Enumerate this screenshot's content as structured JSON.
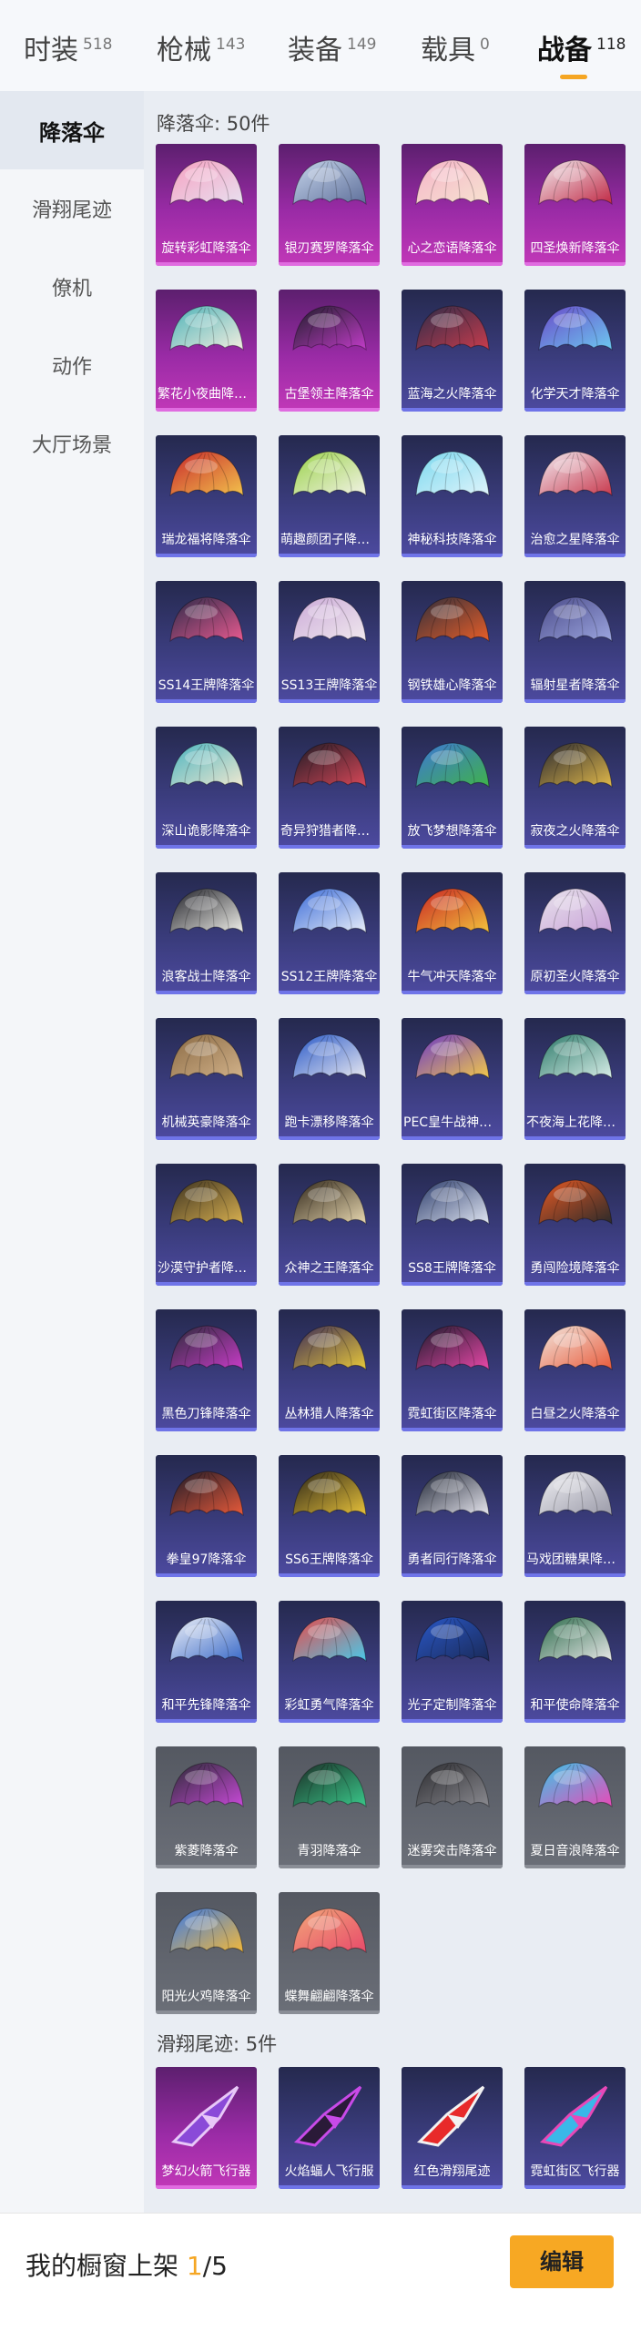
{
  "tabs": [
    {
      "name": "时装",
      "count": "518"
    },
    {
      "name": "枪械",
      "count": "143"
    },
    {
      "name": "装备",
      "count": "149"
    },
    {
      "name": "载具",
      "count": "0"
    },
    {
      "name": "战备",
      "count": "118"
    }
  ],
  "sidebar": [
    "降落伞",
    "滑翔尾迹",
    "僚机",
    "动作",
    "大厅场景"
  ],
  "parachute_section": {
    "title": "降落伞: 50件"
  },
  "trail_section": {
    "title": "滑翔尾迹: 5件"
  },
  "parachutes": [
    {
      "name": "旋转彩虹降落伞",
      "rarity": "purple",
      "colors": [
        "#f6a0c0",
        "#e8e0f0"
      ]
    },
    {
      "name": "银刃赛罗降落伞",
      "rarity": "purple",
      "colors": [
        "#c7d6ec",
        "#5e6f9a"
      ]
    },
    {
      "name": "心之恋语降落伞",
      "rarity": "purple",
      "colors": [
        "#f5b4c9",
        "#f7e3d0"
      ]
    },
    {
      "name": "四圣焕新降落伞",
      "rarity": "purple",
      "colors": [
        "#f3f0f3",
        "#c02844"
      ]
    },
    {
      "name": "繁花小夜曲降落伞",
      "rarity": "purple",
      "colors": [
        "#4cb2b8",
        "#f2eedf"
      ]
    },
    {
      "name": "古堡领主降落伞",
      "rarity": "purple",
      "colors": [
        "#1d1d28",
        "#c13cc8"
      ]
    },
    {
      "name": "蓝海之火降落伞",
      "rarity": "blue",
      "colors": [
        "#2c2c4a",
        "#c83c4c"
      ]
    },
    {
      "name": "化学天才降落伞",
      "rarity": "blue",
      "colors": [
        "#6a48c8",
        "#6cc8f0"
      ]
    },
    {
      "name": "瑞龙福将降落伞",
      "rarity": "blue",
      "colors": [
        "#c8282c",
        "#f2c24c"
      ]
    },
    {
      "name": "萌趣颜团子降落伞",
      "rarity": "blue",
      "colors": [
        "#9ad24a",
        "#f2f2e6"
      ]
    },
    {
      "name": "神秘科技降落伞",
      "rarity": "blue",
      "colors": [
        "#7ad8ee",
        "#dff4fb"
      ]
    },
    {
      "name": "治愈之星降落伞",
      "rarity": "blue",
      "colors": [
        "#f2eef4",
        "#c8384c"
      ]
    },
    {
      "name": "SS14王牌降落伞",
      "rarity": "blue",
      "colors": [
        "#2a2a48",
        "#e85a90"
      ]
    },
    {
      "name": "SS13王牌降落伞",
      "rarity": "blue",
      "colors": [
        "#cbaad8",
        "#f0e8ee"
      ]
    },
    {
      "name": "钢铁雄心降落伞",
      "rarity": "blue",
      "colors": [
        "#2e2e3c",
        "#e85e28"
      ]
    },
    {
      "name": "辐射星者降落伞",
      "rarity": "blue",
      "colors": [
        "#4a4a88",
        "#9ca6e0"
      ]
    },
    {
      "name": "深山诡影降落伞",
      "rarity": "blue",
      "colors": [
        "#4ab4c0",
        "#f0e8d0"
      ]
    },
    {
      "name": "奇异狩猎者降落伞",
      "rarity": "blue",
      "colors": [
        "#1a1a24",
        "#d84858"
      ]
    },
    {
      "name": "放飞梦想降落伞",
      "rarity": "blue",
      "colors": [
        "#3e76d8",
        "#3fb24a"
      ]
    },
    {
      "name": "寂夜之火降落伞",
      "rarity": "blue",
      "colors": [
        "#262630",
        "#e0b84a"
      ]
    },
    {
      "name": "浪客战士降落伞",
      "rarity": "blue",
      "colors": [
        "#1e1e26",
        "#f0f0ea"
      ]
    },
    {
      "name": "SS12王牌降落伞",
      "rarity": "blue",
      "colors": [
        "#3a6ad8",
        "#e8eef8"
      ]
    },
    {
      "name": "牛气冲天降落伞",
      "rarity": "blue",
      "colors": [
        "#c82424",
        "#f2c23c"
      ]
    },
    {
      "name": "原初圣火降落伞",
      "rarity": "blue",
      "colors": [
        "#e8e4ec",
        "#c8a0d8"
      ]
    },
    {
      "name": "机械英豪降落伞",
      "rarity": "blue",
      "colors": [
        "#8a6a44",
        "#d2b28a"
      ]
    },
    {
      "name": "跑卡漂移降落伞",
      "rarity": "blue",
      "colors": [
        "#2858c8",
        "#e8e8f0"
      ]
    },
    {
      "name": "PEC皇牛战神降落伞",
      "rarity": "blue",
      "colors": [
        "#6a38c8",
        "#f2c84a"
      ]
    },
    {
      "name": "不夜海上花降落伞",
      "rarity": "blue",
      "colors": [
        "#2a7868",
        "#d8eee8"
      ]
    },
    {
      "name": "沙漠守护者降落伞",
      "rarity": "blue",
      "colors": [
        "#3a3020",
        "#d8b050"
      ]
    },
    {
      "name": "众神之王降落伞",
      "rarity": "blue",
      "colors": [
        "#2e2418",
        "#e8d8b0"
      ]
    },
    {
      "name": "SS8王牌降落伞",
      "rarity": "blue",
      "colors": [
        "#2a3a6a",
        "#e0e6f2"
      ]
    },
    {
      "name": "勇闯险境降落伞",
      "rarity": "blue",
      "colors": [
        "#e85a24",
        "#2a2a2a"
      ]
    },
    {
      "name": "黑色刀锋降落伞",
      "rarity": "blue",
      "colors": [
        "#2a2a38",
        "#c83cc8"
      ]
    },
    {
      "name": "丛林猎人降落伞",
      "rarity": "blue",
      "colors": [
        "#3a2a58",
        "#e8c83a"
      ]
    },
    {
      "name": "霓虹街区降落伞",
      "rarity": "blue",
      "colors": [
        "#1a1a2a",
        "#e848a8"
      ]
    },
    {
      "name": "白昼之火降落伞",
      "rarity": "blue",
      "colors": [
        "#f2e8e0",
        "#e85a3a"
      ]
    },
    {
      "name": "拳皇97降落伞",
      "rarity": "blue",
      "colors": [
        "#1a1a28",
        "#e85a3a"
      ]
    },
    {
      "name": "SS6王牌降落伞",
      "rarity": "blue",
      "colors": [
        "#2a2418",
        "#e8c23a"
      ]
    },
    {
      "name": "勇者同行降落伞",
      "rarity": "blue",
      "colors": [
        "#1a2030",
        "#e8e8f0"
      ]
    },
    {
      "name": "马戏团糖果降落伞",
      "rarity": "blue",
      "colors": [
        "#f0f0f4",
        "#9a9aa8"
      ]
    },
    {
      "name": "和平先锋降落伞",
      "rarity": "blue",
      "colors": [
        "#f0f2f8",
        "#3a6ac8"
      ]
    },
    {
      "name": "彩虹勇气降落伞",
      "rarity": "blue",
      "colors": [
        "#e84a4a",
        "#4ac8e8"
      ]
    },
    {
      "name": "光子定制降落伞",
      "rarity": "blue",
      "colors": [
        "#2a58c8",
        "#1a2a58"
      ]
    },
    {
      "name": "和平使命降落伞",
      "rarity": "blue",
      "colors": [
        "#2a6a4a",
        "#e8e8e8"
      ]
    },
    {
      "name": "紫菱降落伞",
      "rarity": "gray",
      "colors": [
        "#2a2a34",
        "#c84ad8"
      ]
    },
    {
      "name": "青羽降落伞",
      "rarity": "gray",
      "colors": [
        "#1a2a24",
        "#3ac88a"
      ]
    },
    {
      "name": "迷雾突击降落伞",
      "rarity": "gray",
      "colors": [
        "#2a2a2e",
        "#8a8a90"
      ]
    },
    {
      "name": "夏日音浪降落伞",
      "rarity": "gray",
      "colors": [
        "#3ac8e8",
        "#e84ab8"
      ]
    },
    {
      "name": "阳光火鸡降落伞",
      "rarity": "gray",
      "colors": [
        "#3a7ae8",
        "#f2b83a"
      ]
    },
    {
      "name": "蝶舞翩翩降落伞",
      "rarity": "gray",
      "colors": [
        "#f2a87a",
        "#e84a6a"
      ]
    }
  ],
  "trails": [
    {
      "name": "梦幻火箭飞行器",
      "rarity": "purple",
      "colors": [
        "#8a4ad8",
        "#e8c8f8"
      ]
    },
    {
      "name": "火焰蝠人飞行服",
      "rarity": "blue",
      "colors": [
        "#2a1a38",
        "#c84ae8"
      ]
    },
    {
      "name": "红色滑翔尾迹",
      "rarity": "blue",
      "colors": [
        "#e82a2a",
        "#f2f2f2"
      ]
    },
    {
      "name": "霓虹街区飞行器",
      "rarity": "blue",
      "colors": [
        "#3ab8e8",
        "#e848b8"
      ]
    }
  ],
  "showcase": {
    "prefix": "我的橱窗上架 ",
    "current": "1",
    "suffix": "/5"
  },
  "edit_label": "编辑"
}
